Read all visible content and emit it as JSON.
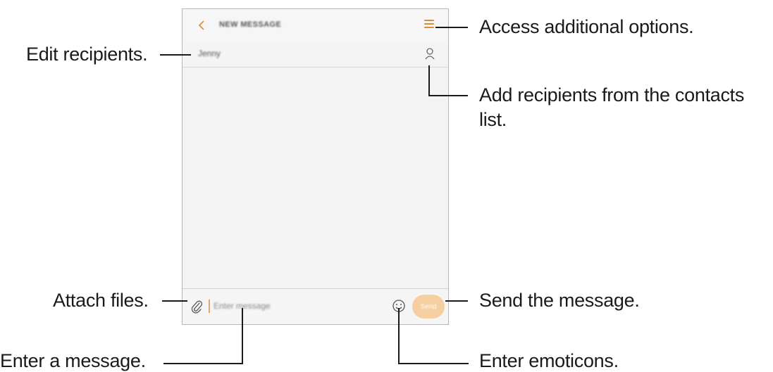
{
  "screen": {
    "title": "NEW MESSAGE",
    "recipient": "Jenny",
    "message_placeholder": "Enter message",
    "send_label": "Send"
  },
  "callouts": {
    "options": "Access additional options.",
    "edit_recipients": "Edit recipients.",
    "contacts_line1": "Add recipients from the contacts",
    "contacts_line2": "list.",
    "attach": "Attach files.",
    "send": "Send the message.",
    "enter_message": "Enter a message.",
    "emoticons": "Enter emoticons."
  },
  "icons": {
    "back": "back-arrow",
    "more": "more-options",
    "contact": "contact-person",
    "attach": "paperclip",
    "emoticon": "smiley-face"
  },
  "colors": {
    "accent": "#d98a3a",
    "send_button": "#f5cf9f",
    "callout_text": "#1a1a1a"
  }
}
